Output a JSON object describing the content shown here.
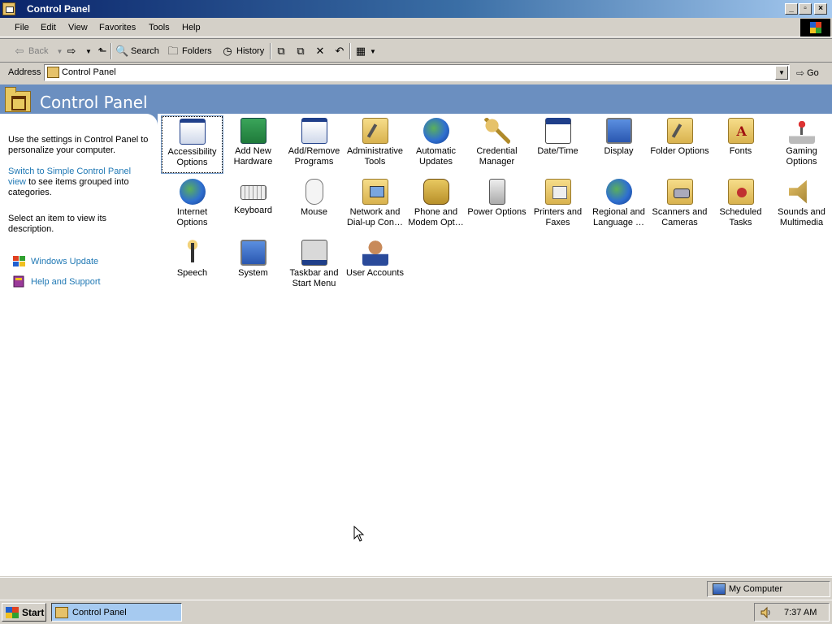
{
  "window": {
    "title": "Control Panel"
  },
  "menu": [
    "File",
    "Edit",
    "View",
    "Favorites",
    "Tools",
    "Help"
  ],
  "toolbar": {
    "back": "Back",
    "search": "Search",
    "folders": "Folders",
    "history": "History"
  },
  "address": {
    "label": "Address",
    "value": "Control Panel",
    "go": "Go"
  },
  "banner": {
    "title": "Control Panel"
  },
  "sidebar": {
    "intro": "Use the settings in Control Panel to personalize your computer.",
    "switch_link": "Switch to Simple Control Panel view",
    "switch_rest": "to see items grouped into categories.",
    "hint": "Select an item to view its description.",
    "links": [
      "Windows Update",
      "Help and Support"
    ]
  },
  "items": [
    {
      "label": "Accessibility\nOptions",
      "icon": "accessibility-icon"
    },
    {
      "label": "Add New\nHardware",
      "icon": "hardware-icon"
    },
    {
      "label": "Add/Remove\nPrograms",
      "icon": "programs-icon"
    },
    {
      "label": "Administrative\nTools",
      "icon": "admin-tools-icon"
    },
    {
      "label": "Automatic\nUpdates",
      "icon": "updates-icon"
    },
    {
      "label": "Credential\nManager",
      "icon": "keys-icon"
    },
    {
      "label": "Date/Time",
      "icon": "calendar-icon"
    },
    {
      "label": "Display",
      "icon": "display-icon"
    },
    {
      "label": "Folder Options",
      "icon": "folder-options-icon"
    },
    {
      "label": "Fonts",
      "icon": "fonts-icon"
    },
    {
      "label": "Gaming\nOptions",
      "icon": "joystick-icon"
    },
    {
      "label": "Internet\nOptions",
      "icon": "internet-icon"
    },
    {
      "label": "Keyboard",
      "icon": "keyboard-icon"
    },
    {
      "label": "Mouse",
      "icon": "mouse-icon"
    },
    {
      "label": "Network and\nDial-up Con…",
      "icon": "network-icon"
    },
    {
      "label": "Phone and\nModem Opt…",
      "icon": "phone-icon"
    },
    {
      "label": "Power Options",
      "icon": "power-icon"
    },
    {
      "label": "Printers and\nFaxes",
      "icon": "printer-icon"
    },
    {
      "label": "Regional and\nLanguage …",
      "icon": "globe-icon"
    },
    {
      "label": "Scanners and\nCameras",
      "icon": "camera-icon"
    },
    {
      "label": "Scheduled\nTasks",
      "icon": "tasks-icon"
    },
    {
      "label": "Sounds and\nMultimedia",
      "icon": "speaker-icon"
    },
    {
      "label": "Speech",
      "icon": "microphone-icon"
    },
    {
      "label": "System",
      "icon": "computer-icon"
    },
    {
      "label": "Taskbar and\nStart Menu",
      "icon": "taskbar-icon"
    },
    {
      "label": "User Accounts",
      "icon": "users-icon"
    }
  ],
  "status": {
    "zone": "My Computer"
  },
  "taskbar": {
    "start": "Start",
    "task": "Control Panel",
    "clock": "7:37 AM"
  }
}
